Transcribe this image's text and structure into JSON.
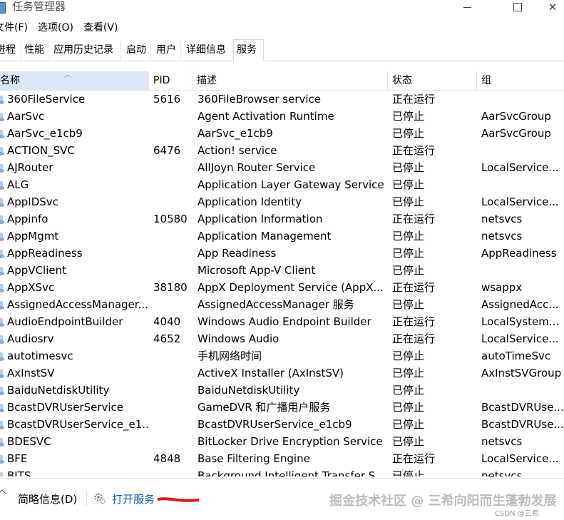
{
  "window": {
    "title": "任务管理器",
    "accent": "#1a5fb4"
  },
  "menu": [
    "文件(F)",
    "选项(O)",
    "查看(V)"
  ],
  "tabs": [
    "进程",
    "性能",
    "应用历史记录",
    "启动",
    "用户",
    "详细信息",
    "服务"
  ],
  "active_tab": "服务",
  "columns": [
    "名称",
    "PID",
    "描述",
    "状态",
    "组"
  ],
  "services": [
    {
      "name": "360FileService",
      "pid": "5616",
      "desc": "360FileBrowser service",
      "status": "正在运行",
      "group": ""
    },
    {
      "name": "AarSvc",
      "pid": "",
      "desc": "Agent Activation Runtime",
      "status": "已停止",
      "group": "AarSvcGroup"
    },
    {
      "name": "AarSvc_e1cb9",
      "pid": "",
      "desc": "AarSvc_e1cb9",
      "status": "已停止",
      "group": "AarSvcGroup"
    },
    {
      "name": "ACTION_SVC",
      "pid": "6476",
      "desc": "Action! service",
      "status": "正在运行",
      "group": ""
    },
    {
      "name": "AJRouter",
      "pid": "",
      "desc": "AllJoyn Router Service",
      "status": "已停止",
      "group": "LocalService..."
    },
    {
      "name": "ALG",
      "pid": "",
      "desc": "Application Layer Gateway Service",
      "status": "已停止",
      "group": ""
    },
    {
      "name": "AppIDSvc",
      "pid": "",
      "desc": "Application Identity",
      "status": "已停止",
      "group": "LocalService..."
    },
    {
      "name": "Appinfo",
      "pid": "10580",
      "desc": "Application Information",
      "status": "正在运行",
      "group": "netsvcs"
    },
    {
      "name": "AppMgmt",
      "pid": "",
      "desc": "Application Management",
      "status": "已停止",
      "group": "netsvcs"
    },
    {
      "name": "AppReadiness",
      "pid": "",
      "desc": "App Readiness",
      "status": "已停止",
      "group": "AppReadiness"
    },
    {
      "name": "AppVClient",
      "pid": "",
      "desc": "Microsoft App-V Client",
      "status": "已停止",
      "group": ""
    },
    {
      "name": "AppXSvc",
      "pid": "38180",
      "desc": "AppX Deployment Service (AppX...",
      "status": "正在运行",
      "group": "wsappx"
    },
    {
      "name": "AssignedAccessManager...",
      "pid": "",
      "desc": "AssignedAccessManager 服务",
      "status": "已停止",
      "group": "AssignedAcc..."
    },
    {
      "name": "AudioEndpointBuilder",
      "pid": "4040",
      "desc": "Windows Audio Endpoint Builder",
      "status": "正在运行",
      "group": "LocalSystem..."
    },
    {
      "name": "Audiosrv",
      "pid": "4652",
      "desc": "Windows Audio",
      "status": "正在运行",
      "group": "LocalService..."
    },
    {
      "name": "autotimesvc",
      "pid": "",
      "desc": "手机网络时间",
      "status": "已停止",
      "group": "autoTimeSvc"
    },
    {
      "name": "AxInstSV",
      "pid": "",
      "desc": "ActiveX Installer (AxInstSV)",
      "status": "已停止",
      "group": "AxInstSVGroup"
    },
    {
      "name": "BaiduNetdiskUtility",
      "pid": "",
      "desc": "BaiduNetdiskUtility",
      "status": "已停止",
      "group": ""
    },
    {
      "name": "BcastDVRUserService",
      "pid": "",
      "desc": "GameDVR 和广播用户服务",
      "status": "已停止",
      "group": "BcastDVRUse..."
    },
    {
      "name": "BcastDVRUserService_e1...",
      "pid": "",
      "desc": "BcastDVRUserService_e1cb9",
      "status": "已停止",
      "group": "BcastDVRUse..."
    },
    {
      "name": "BDESVC",
      "pid": "",
      "desc": "BitLocker Drive Encryption Service",
      "status": "已停止",
      "group": "netsvcs"
    },
    {
      "name": "BFE",
      "pid": "4848",
      "desc": "Base Filtering Engine",
      "status": "正在运行",
      "group": "LocalService..."
    },
    {
      "name": "BITS",
      "pid": "",
      "desc": "Background Intelligent Transfer S...",
      "status": "已停止",
      "group": "netsvcs"
    }
  ],
  "footer": {
    "brief_label": "简略信息(D)",
    "open_services_label": "打开服务",
    "watermark": "掘金技术社区 @ 三希向阳而生蓬勃发展",
    "csdn": "CSDN @三希"
  }
}
